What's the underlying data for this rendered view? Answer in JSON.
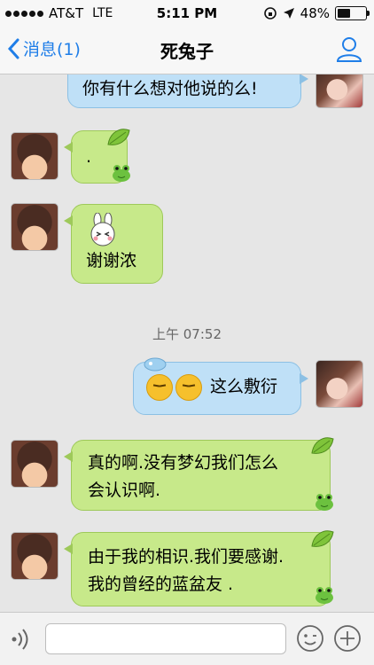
{
  "status_bar": {
    "carrier": "AT&T",
    "network": "LTE",
    "time": "5:11 PM",
    "battery": "48%",
    "battery_level": 0.48
  },
  "nav": {
    "back_label": "消息(1)",
    "title": "死兔子",
    "back_icon": "chevron-left-icon",
    "profile_icon": "user-icon",
    "accent": "#1f7ee8"
  },
  "messages": [
    {
      "side": "right",
      "text": "你有什么想对他说的么!"
    },
    {
      "side": "left",
      "text": "."
    },
    {
      "side": "left",
      "text": "谢谢浓",
      "sticker": "bunny-face-icon"
    },
    {
      "side": "right",
      "text": "这么敷衍",
      "emoji": "annoyed-face-icon"
    },
    {
      "side": "left",
      "text_line1": "真的啊.没有梦幻我们怎么",
      "text_line2": "会认识啊."
    },
    {
      "side": "left",
      "text_line1": "由于我的相识.我们要感谢.",
      "text_line2": "我的曾经的蓝盆友 ."
    }
  ],
  "timestamp": "上午 07:52",
  "input_bar": {
    "value": "",
    "voice_icon": "voice-icon",
    "emoji_icon": "smiley-icon",
    "plus_icon": "plus-icon"
  },
  "colors": {
    "incoming_bubble": "#c7e98a",
    "outgoing_bubble": "#bfe0f7",
    "background": "#e6e6e6"
  }
}
